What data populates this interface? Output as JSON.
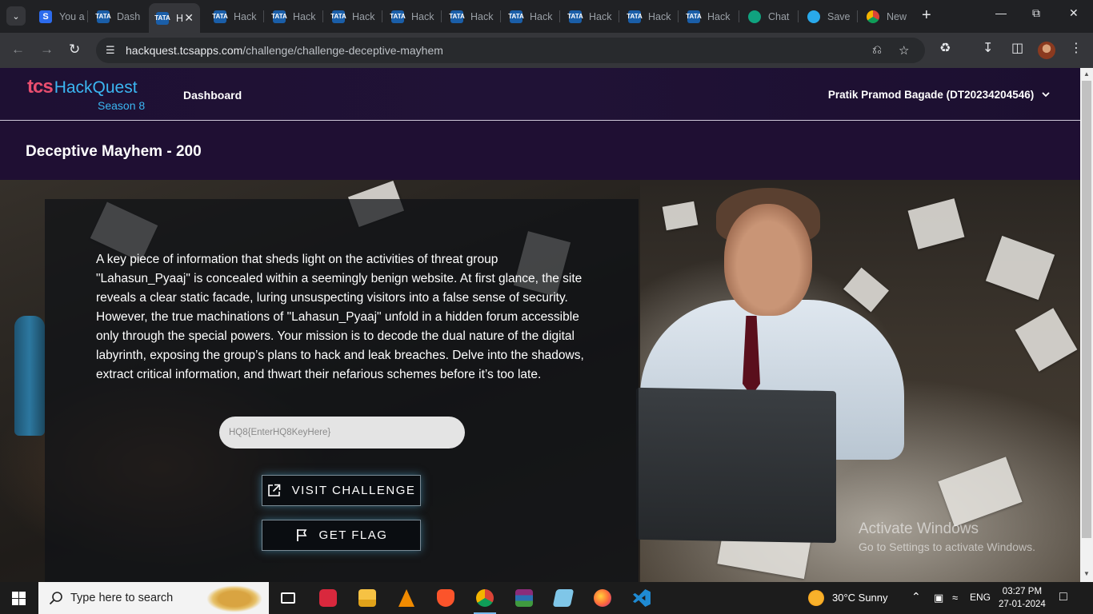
{
  "browser": {
    "tabs": [
      {
        "label": "You a",
        "favicon": "s"
      },
      {
        "label": "Dash",
        "favicon": "tata"
      },
      {
        "label": "H",
        "favicon": "tata",
        "active": true
      },
      {
        "label": "Hack",
        "favicon": "tata"
      },
      {
        "label": "Hack",
        "favicon": "tata"
      },
      {
        "label": "Hack",
        "favicon": "tata"
      },
      {
        "label": "Hack",
        "favicon": "tata"
      },
      {
        "label": "Hack",
        "favicon": "tata"
      },
      {
        "label": "Hack",
        "favicon": "tata"
      },
      {
        "label": "Hack",
        "favicon": "tata"
      },
      {
        "label": "Hack",
        "favicon": "tata"
      },
      {
        "label": "Hack",
        "favicon": "tata"
      },
      {
        "label": "Chat",
        "favicon": "gpt"
      },
      {
        "label": "Save",
        "favicon": "tg"
      },
      {
        "label": "New",
        "favicon": "chrome"
      }
    ],
    "url_host": "hackquest.tcsapps.com",
    "url_path": "/challenge/challenge-deceptive-mayhem",
    "tata_badge": "TATA"
  },
  "site": {
    "logo_tcs": "tcs",
    "logo_name": "HackQuest",
    "logo_season": "Season 8",
    "nav_dashboard": "Dashboard",
    "user_name": "Pratik Pramod Bagade (DT20234204546)"
  },
  "challenge": {
    "title": "Deceptive Mayhem - 200",
    "description": "A key piece of information that sheds light on the activities of threat group \"Lahasun_Pyaaj\" is concealed within a seemingly benign website. At first glance, the site reveals a clear static facade, luring unsuspecting visitors into a false sense of security. However, the true machinations of \"Lahasun_Pyaaj\" unfold in a hidden forum accessible only through the special powers. Your mission is to decode the dual nature of the digital labyrinth, exposing the group’s plans to hack and leak breaches. Delve into the shadows, extract critical information, and thwart their nefarious schemes before it’s too late.",
    "flag_placeholder": "HQ8{EnterHQ8KeyHere}",
    "visit_label": "VISIT CHALLENGE",
    "flag_label": "GET FLAG"
  },
  "watermark": {
    "line1": "Activate Windows",
    "line2": "Go to Settings to activate Windows."
  },
  "taskbar": {
    "search_placeholder": "Type here to search",
    "weather": "30°C  Sunny",
    "language": "ENG",
    "time": "03:27 PM",
    "date": "27-01-2024"
  },
  "colors": {
    "header_bg": "#1e1033",
    "accent_blue": "#3bb6f2",
    "tcs_pink": "#e94e6f",
    "button_glow": "#50aad2"
  }
}
